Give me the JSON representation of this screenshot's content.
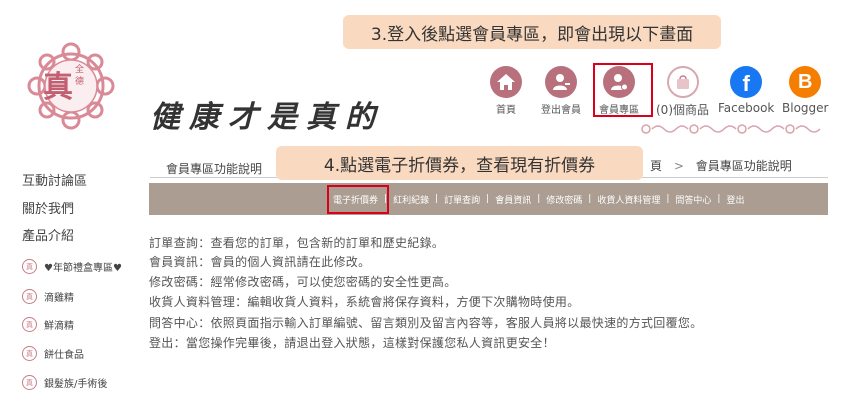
{
  "callouts": {
    "step3": "3.登入後點選會員專區，即會出現以下畫面",
    "step4": "4.點選電子折價券，查看現有折價券"
  },
  "brand": {
    "seal_text": "真",
    "seal_sub": "全 德",
    "slogan": "健康才是真的"
  },
  "nav": {
    "home": "首頁",
    "logout": "登出會員",
    "member": "會員專區",
    "cart": "(0)個商品",
    "facebook": "Facebook",
    "blogger": "Blogger"
  },
  "colors": {
    "accent": "#d9001b",
    "menubar": "#ab9d91",
    "callout": "#f9d9bf",
    "nav_icon": "#b8707c"
  },
  "sidebar": {
    "links": [
      "互動討論區",
      "關於我們",
      "產品介紹"
    ],
    "categories": [
      "♥年節禮盒專區♥",
      "滴雞精",
      "鮮滴精",
      "餅仕食品",
      "銀髮族/手術後"
    ]
  },
  "member": {
    "section_title": "會員專區功能說明",
    "breadcrumb_sep": "頁",
    "breadcrumb_current": "會員專區功能說明",
    "menu": [
      "電子折價券",
      "紅利紀錄",
      "訂單查詢",
      "會員資訊",
      "修改密碼",
      "收貨人資料管理",
      "問答中心",
      "登出"
    ],
    "descriptions": [
      "訂單查詢：查看您的訂單，包含新的訂單和歷史紀錄。",
      "會員資訊：會員的個人資訊請在此修改。",
      "修改密碼：經常修改密碼，可以使您密碼的安全性更高。",
      "收貨人資料管理：編輯收貨人資料，系統會將保存資料，方便下次購物時使用。",
      "問答中心：依照頁面指示輸入訂單編號、留言類別及留言內容等，客服人員將以最快速的方式回覆您。",
      "登出：當您操作完畢後，請退出登入狀態，這樣對保護您私人資訊更安全！"
    ]
  }
}
